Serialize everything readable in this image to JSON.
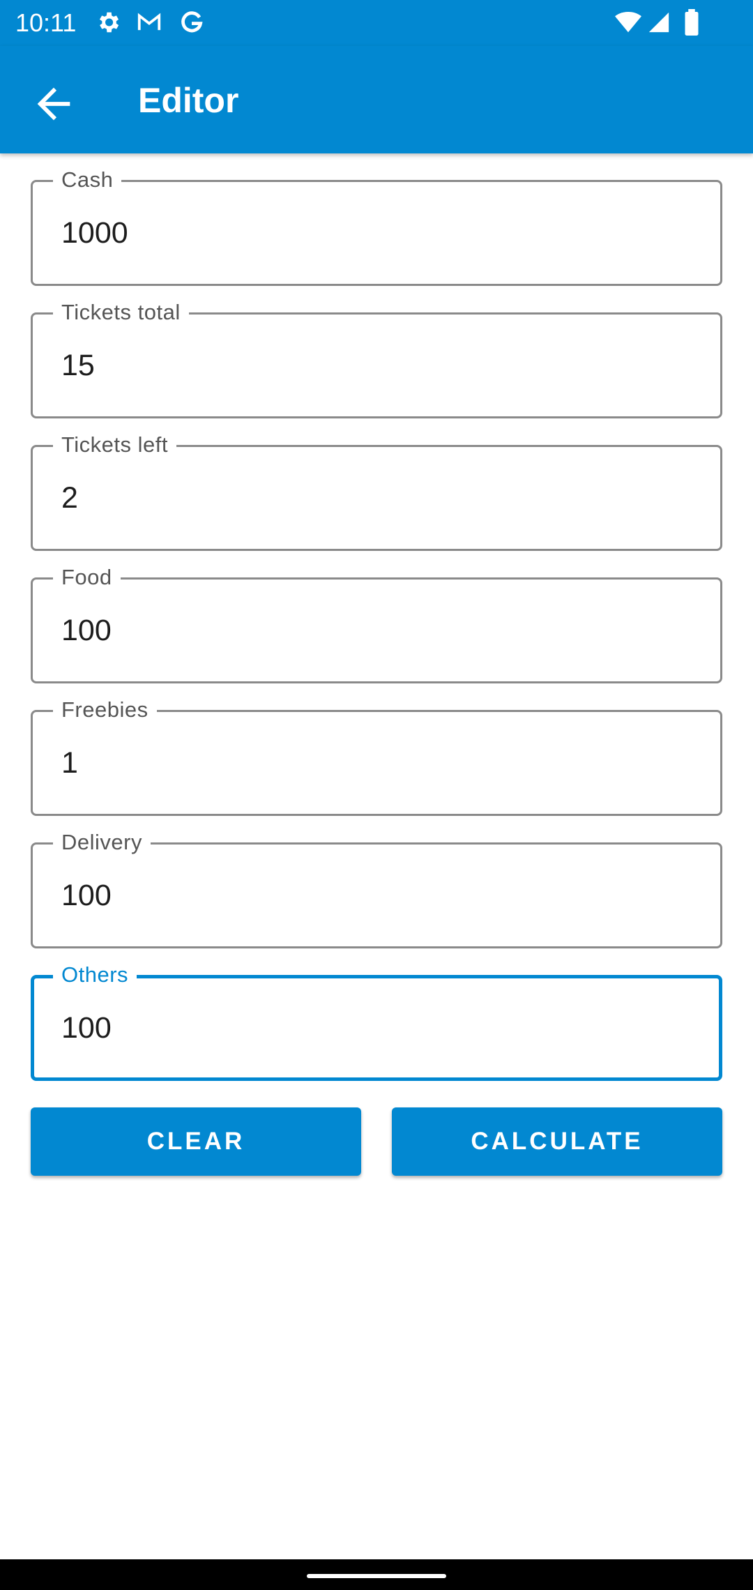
{
  "status_bar": {
    "time": "10:11",
    "icons": [
      "settings-icon",
      "gmail-icon",
      "google-icon",
      "wifi-icon",
      "signal-icon",
      "battery-icon"
    ]
  },
  "app_bar": {
    "back_icon": "arrow-back-icon",
    "title": "Editor"
  },
  "form": {
    "fields": [
      {
        "label": "Cash",
        "value": "1000"
      },
      {
        "label": "Tickets total",
        "value": "15"
      },
      {
        "label": "Tickets left",
        "value": "2"
      },
      {
        "label": "Food",
        "value": "100"
      },
      {
        "label": "Freebies",
        "value": "1"
      },
      {
        "label": "Delivery",
        "value": "100"
      },
      {
        "label": "Others",
        "value": "100",
        "focused": true
      }
    ]
  },
  "buttons": {
    "clear": "CLEAR",
    "calculate": "CALCULATE"
  },
  "colors": {
    "primary": "#0288D1",
    "outline": "#8a8a8a",
    "label": "#555555"
  }
}
